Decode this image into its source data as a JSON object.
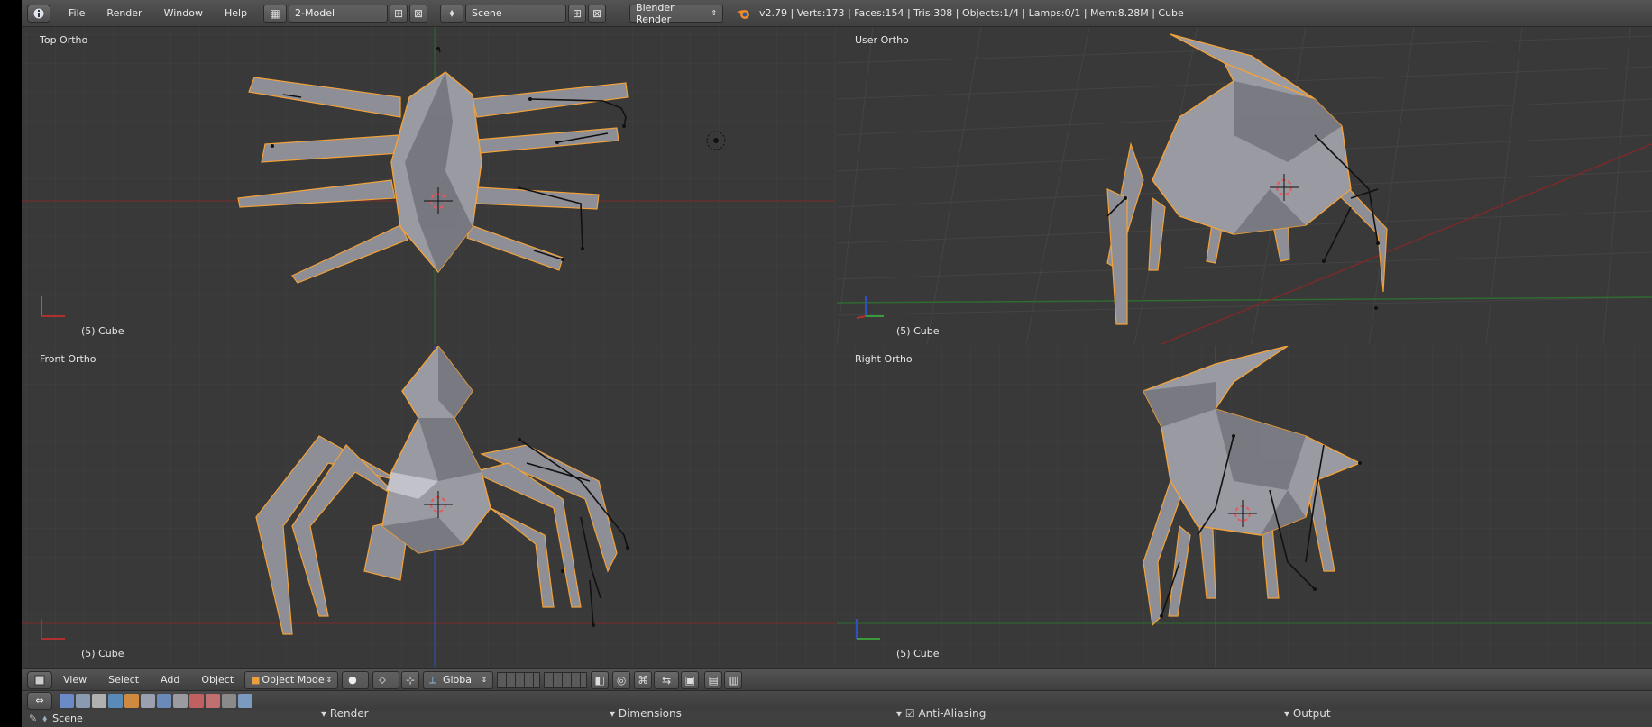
{
  "topbar": {
    "menus": [
      "File",
      "Render",
      "Window",
      "Help"
    ],
    "screen_layout": "2-Model",
    "scene": "Scene",
    "render_engine": "Blender Render",
    "stats": "v2.79 | Verts:173 | Faces:154 | Tris:308 | Objects:1/4 | Lamps:0/1 | Mem:8.28M | Cube"
  },
  "viewports": [
    {
      "name": "Top Ortho",
      "object": "(5) Cube",
      "axis1": "y",
      "axis2": "x"
    },
    {
      "name": "User Ortho",
      "object": "(5) Cube",
      "axis1": "z",
      "axis2": "y"
    },
    {
      "name": "Front Ortho",
      "object": "(5) Cube",
      "axis1": "z",
      "axis2": "x"
    },
    {
      "name": "Right Ortho",
      "object": "(5) Cube",
      "axis1": "z",
      "axis2": "y"
    }
  ],
  "view_header": {
    "menus": [
      "View",
      "Select",
      "Add",
      "Object"
    ],
    "mode": "Object Mode",
    "orientation": "Global"
  },
  "properties": {
    "context": "Scene",
    "panels": [
      "Render",
      "Dimensions",
      "Anti-Aliasing",
      "Output"
    ]
  },
  "colors": {
    "mesh_fill": "#8e8e96",
    "selection_outline": "#f2a23a",
    "x_axis": "#b03030",
    "y_axis": "#3a9a3a",
    "z_axis": "#3050c0",
    "viewport_bg": "#393939"
  }
}
